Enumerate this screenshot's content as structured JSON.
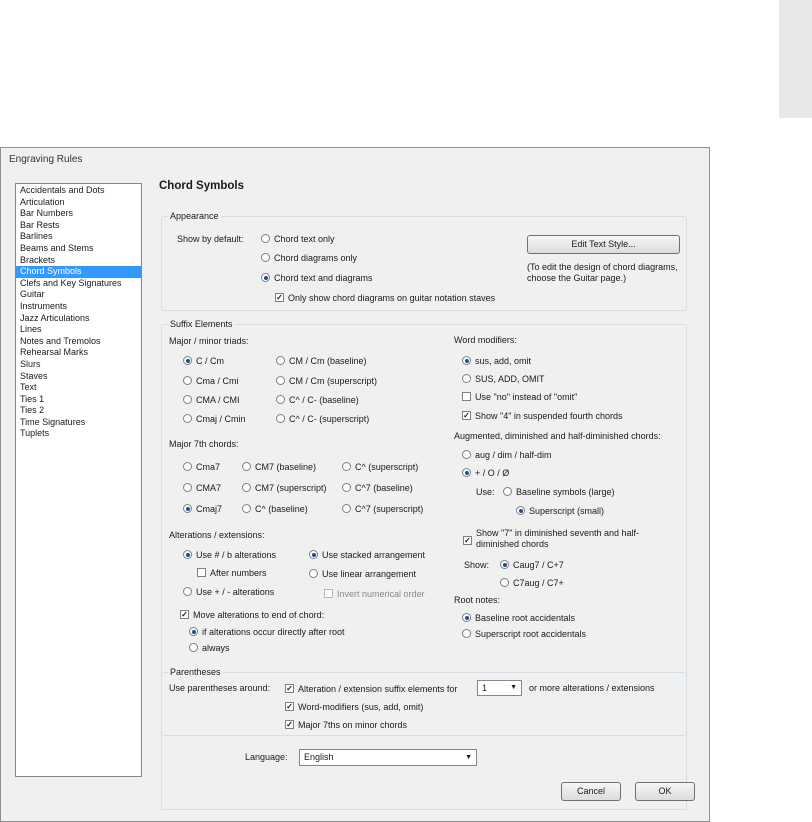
{
  "window_title": "Engraving Rules",
  "sidebar": {
    "items": [
      "Accidentals and Dots",
      "Articulation",
      "Bar Numbers",
      "Bar Rests",
      "Barlines",
      "Beams and Stems",
      "Brackets",
      "Chord Symbols",
      "Clefs and Key Signatures",
      "Guitar",
      "Instruments",
      "Jazz Articulations",
      "Lines",
      "Notes and Tremolos",
      "Rehearsal Marks",
      "Slurs",
      "Staves",
      "Text",
      "Ties 1",
      "Ties 2",
      "Time Signatures",
      "Tuplets"
    ],
    "selected": "Chord Symbols"
  },
  "page_title": "Chord Symbols",
  "appearance": {
    "group_label": "Appearance",
    "show_by_default_label": "Show by default:",
    "options": [
      "Chord text only",
      "Chord diagrams only",
      "Chord text and diagrams"
    ],
    "selected": "Chord text and diagrams",
    "guitar_only_check": "Only show chord diagrams on guitar notation staves",
    "guitar_only_checked": true,
    "edit_text_style_button": "Edit Text Style...",
    "note": "(To edit the design of chord diagrams, choose the Guitar page.)"
  },
  "suffix": {
    "group_label": "Suffix Elements",
    "triads_label": "Major / minor triads:",
    "triads": [
      "C / Cm",
      "CM / Cm (baseline)",
      "Cma / Cmi",
      "CM / Cm (superscript)",
      "CMA / CMI",
      "C^ / C- (baseline)",
      "Cmaj / Cmin",
      "C^ / C- (superscript)"
    ],
    "triads_selected": "C / Cm",
    "seventh_label": "Major 7th chords:",
    "sevenths": [
      "Cma7",
      "CM7 (baseline)",
      "C^ (superscript)",
      "CMA7",
      "CM7 (superscript)",
      "C^7 (baseline)",
      "Cmaj7",
      "C^ (baseline)",
      "C^7 (superscript)"
    ],
    "seventh_selected": "Cmaj7",
    "alterations_label": "Alterations / extensions:",
    "use_sharp_flat": "Use # / b alterations",
    "after_numbers": "After numbers",
    "use_plus_minus": "Use + / - alterations",
    "use_stacked": "Use stacked arrangement",
    "use_linear": "Use linear arrangement",
    "invert_numerical": "Invert numerical order",
    "move_alterations": "Move alterations to end of chord:",
    "if_directly_after": "if alterations occur directly after root",
    "always": "always",
    "word_modifiers_label": "Word modifiers:",
    "word_options": [
      "sus, add, omit",
      "SUS, ADD, OMIT"
    ],
    "use_no": "Use \"no\" instead of \"omit\"",
    "show_4": "Show \"4\" in suspended fourth chords",
    "aug_label": "Augmented, diminished and half-diminished chords:",
    "aug_options": [
      "aug / dim / half-dim",
      "+ / O / Ø"
    ],
    "use_label": "Use:",
    "baseline_symbols": "Baseline symbols (large)",
    "superscript_small": "Superscript (small)",
    "show_7": "Show \"7\" in diminished seventh and half-diminished chords",
    "show_label": "Show:",
    "show_options": [
      "Caug7 / C+7",
      "C7aug / C7+"
    ],
    "root_label": "Root notes:",
    "root_options": [
      "Baseline root accidentals",
      "Superscript root accidentals"
    ]
  },
  "parentheses": {
    "group_label": "Parentheses",
    "use_around_label": "Use parentheses around:",
    "alteration_check": "Alteration / extension suffix elements for",
    "alteration_count": "1",
    "alteration_suffix": "or more alterations / extensions",
    "word_modifiers_check": "Word-modifiers (sus, add, omit)",
    "major7_minor_check": "Major 7ths on minor chords"
  },
  "language": {
    "label": "Language:",
    "value": "English"
  },
  "buttons": {
    "cancel": "Cancel",
    "ok": "OK"
  },
  "colors": {
    "selection": "#3399ff",
    "dialog_bg": "#f0f0f0"
  }
}
